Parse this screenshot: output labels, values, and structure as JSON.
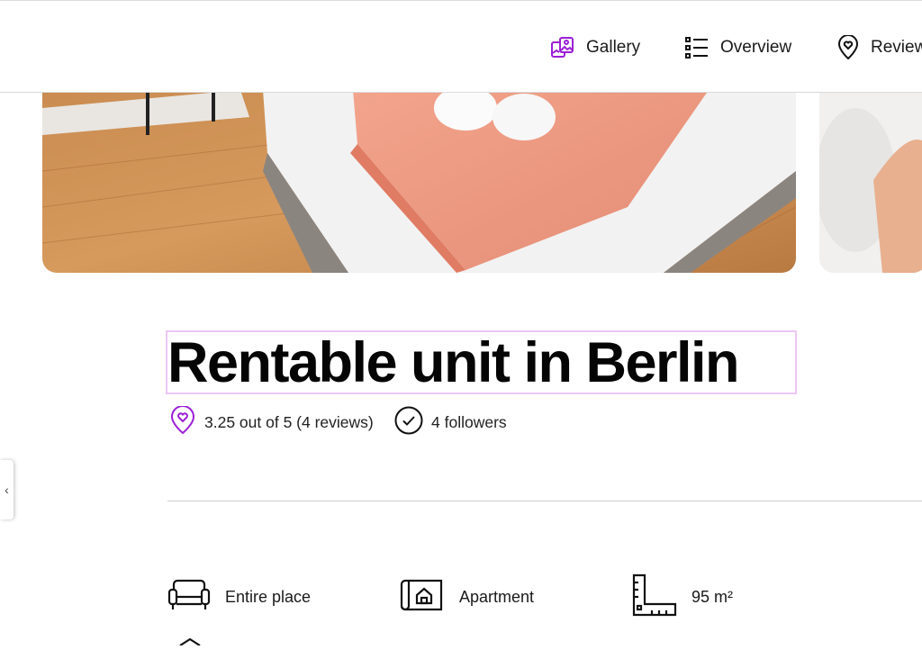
{
  "nav": {
    "items": [
      {
        "label": "Gallery",
        "icon": "gallery-icon",
        "color": "#9b1fd6"
      },
      {
        "label": "Overview",
        "icon": "list-icon"
      },
      {
        "label": "Reviews",
        "icon": "location-pin-icon"
      }
    ]
  },
  "listing": {
    "title": "Rentable unit in Berlin",
    "rating_text": "3.25 out of 5 (4 reviews)",
    "followers_text": "4 followers"
  },
  "features": [
    {
      "label": "Entire place",
      "icon": "sofa-icon"
    },
    {
      "label": "Apartment",
      "icon": "floorplan-house-icon"
    },
    {
      "label": "95 m²",
      "icon": "ruler-icon"
    }
  ],
  "colors": {
    "accent": "#9b1fd6",
    "title_outline": "#ecc6f3"
  }
}
